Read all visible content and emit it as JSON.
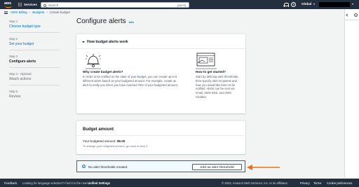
{
  "topnav": {
    "logo": "aws",
    "services": "Services",
    "search_placeholder": "Search",
    "search_shortcut": "[Alt+S]",
    "account": "Global"
  },
  "breadcrumb": [
    "AWS Billing",
    "Budgets",
    "Create budget"
  ],
  "steps": [
    {
      "num": "Step 1",
      "label": "Choose budget type"
    },
    {
      "num": "Step 2",
      "label": "Set your budget"
    },
    {
      "num": "Step 3",
      "label": "Configure alerts"
    },
    {
      "num": "Step 4 - Optional",
      "label": "Attach actions"
    },
    {
      "num": "Step 5",
      "label": "Review"
    }
  ],
  "page": {
    "title": "Configure alerts",
    "info": "Info"
  },
  "how": {
    "header": "How budget alerts work",
    "left_title": "Why create budget alerts?",
    "left_text": "In order to be notified on the state of your budget, you can create up to 5 different alerts based on your budgeted amount. For example, create an alert to notify you when you have reached 75% of your budgeted amount.",
    "right_title": "How to get started?",
    "right_text": "Start by defining alert thresholds, then specify alert recipients and how you would like them to be notified. Alerts can be sent via email, AWS SNS, and AWS Chatbot."
  },
  "amount": {
    "title": "Budget amount",
    "line_label": "Your budgeted amount:",
    "line_value": "$5.00",
    "hint": "To change your budgeted amount, go back to step 2."
  },
  "alert": {
    "text": "No alert thresholds created.",
    "button": "Add an alert threshold"
  },
  "footer": {
    "feedback": "Feedback",
    "lang_prefix": "Looking for language selection? Find it in the new",
    "lang_link": "Unified Settings",
    "copyright": "© 2023, Amazon Web Services, Inc. or its affiliates.",
    "privacy": "Privacy",
    "terms": "Terms",
    "cookies": "Cookie preferences"
  },
  "colors": {
    "nav": "#232f3e",
    "link": "#0073bb",
    "accent_arrow": "#ec7211",
    "info_bg": "#f1faff"
  }
}
